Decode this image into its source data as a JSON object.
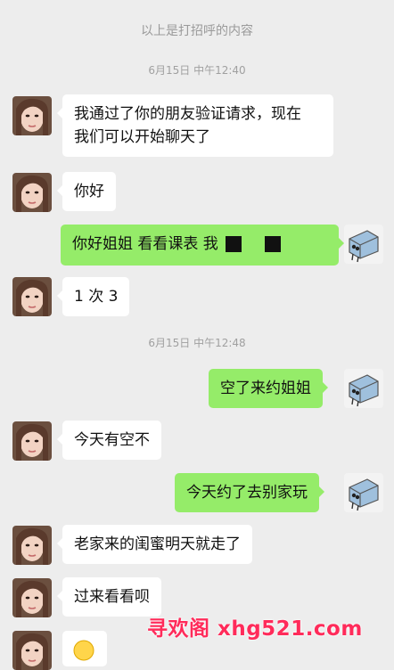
{
  "chat": {
    "system_notice": "以上是打招呼的内容",
    "timestamps": [
      "6月15日 中午12:40",
      "6月15日 中午12:48"
    ],
    "messages": [
      {
        "from": "contact",
        "lines": [
          "我通过了你的朋友验证请求，现在",
          "我们可以开始聊天了"
        ]
      },
      {
        "from": "contact",
        "text": "你好"
      },
      {
        "from": "me",
        "text": "你好姐姐 看看课表 我"
      },
      {
        "from": "contact",
        "text": "1 次 3"
      },
      {
        "from": "me",
        "text": "空了来约姐姐"
      },
      {
        "from": "contact",
        "text": "今天有空不"
      },
      {
        "from": "me",
        "text": "今天约了去别家玩"
      },
      {
        "from": "contact",
        "text": "老家来的闺蜜明天就走了"
      },
      {
        "from": "contact",
        "text": "过来看看呗"
      },
      {
        "from": "contact",
        "text": "emoji-sticker"
      }
    ]
  },
  "watermark": "寻欢阁 xhg521.com",
  "colors": {
    "background": "#ededed",
    "incoming_bubble": "#ffffff",
    "outgoing_bubble": "#95ec69",
    "timestamp_text": "#a0a0a0",
    "watermark": "#ff2b5a"
  }
}
